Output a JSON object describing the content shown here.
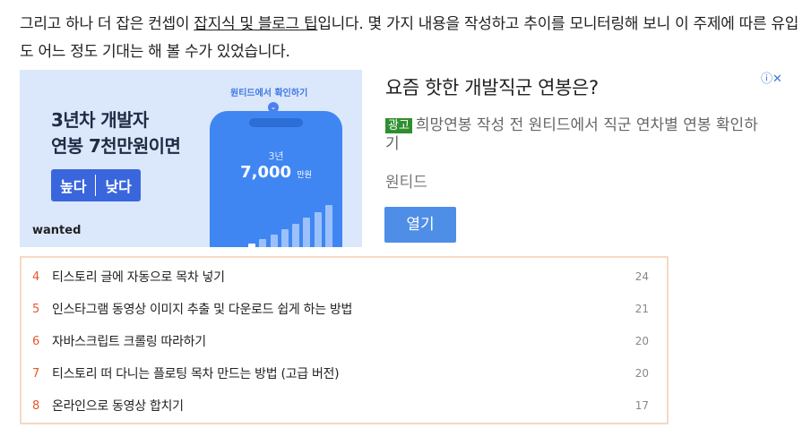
{
  "paragraph": {
    "part1": "그리고 하나 더 잡은 컨셉이 ",
    "link": "잡지식 및 블로그 팁",
    "part2": "입니다. 몇 가지 내용을 작성하고 추이를 모니터링해 보니 이 주제에 따른 유입도 어느 정도 기대는 해 볼 수가 있었습니다."
  },
  "ad_image": {
    "headline_line1": "3년차 개발자",
    "headline_line2": "연봉 7천만원이면",
    "choice_high": "높다",
    "choice_low": "낮다",
    "brand": "wanted",
    "phone_title": "원티드에서 확인하기",
    "phone_year": "3년",
    "phone_salary": "7,000",
    "phone_salary_unit": "만원",
    "bar_heights": [
      0.12,
      0.18,
      0.22,
      0.3,
      0.36,
      0.42,
      0.5,
      0.58,
      0.66,
      0.74,
      0.84
    ]
  },
  "ad": {
    "title": "요즘 핫한 개발직군 연봉은?",
    "tag": "광고",
    "description": "희망연봉 작성 전 원티드에서 직군 연차별 연봉 확인하기",
    "advertiser": "원티드",
    "button": "열기",
    "choices_icon": "ⓘ✕",
    "accent": "#4f8ee7"
  },
  "popular_posts": [
    {
      "rank": "4",
      "title": "티스토리 글에 자동으로 목차 넣기",
      "count": "24"
    },
    {
      "rank": "5",
      "title": "인스타그램 동영상 이미지 추출 및 다운로드 쉽게 하는 방법",
      "count": "21"
    },
    {
      "rank": "6",
      "title": "자바스크립트 크롤링 따라하기",
      "count": "20"
    },
    {
      "rank": "7",
      "title": "티스토리 떠 다니는 플로팅 목차 만드는 방법 (고급 버전)",
      "count": "20"
    },
    {
      "rank": "8",
      "title": "온라인으로 동영상 합치기",
      "count": "17"
    }
  ]
}
